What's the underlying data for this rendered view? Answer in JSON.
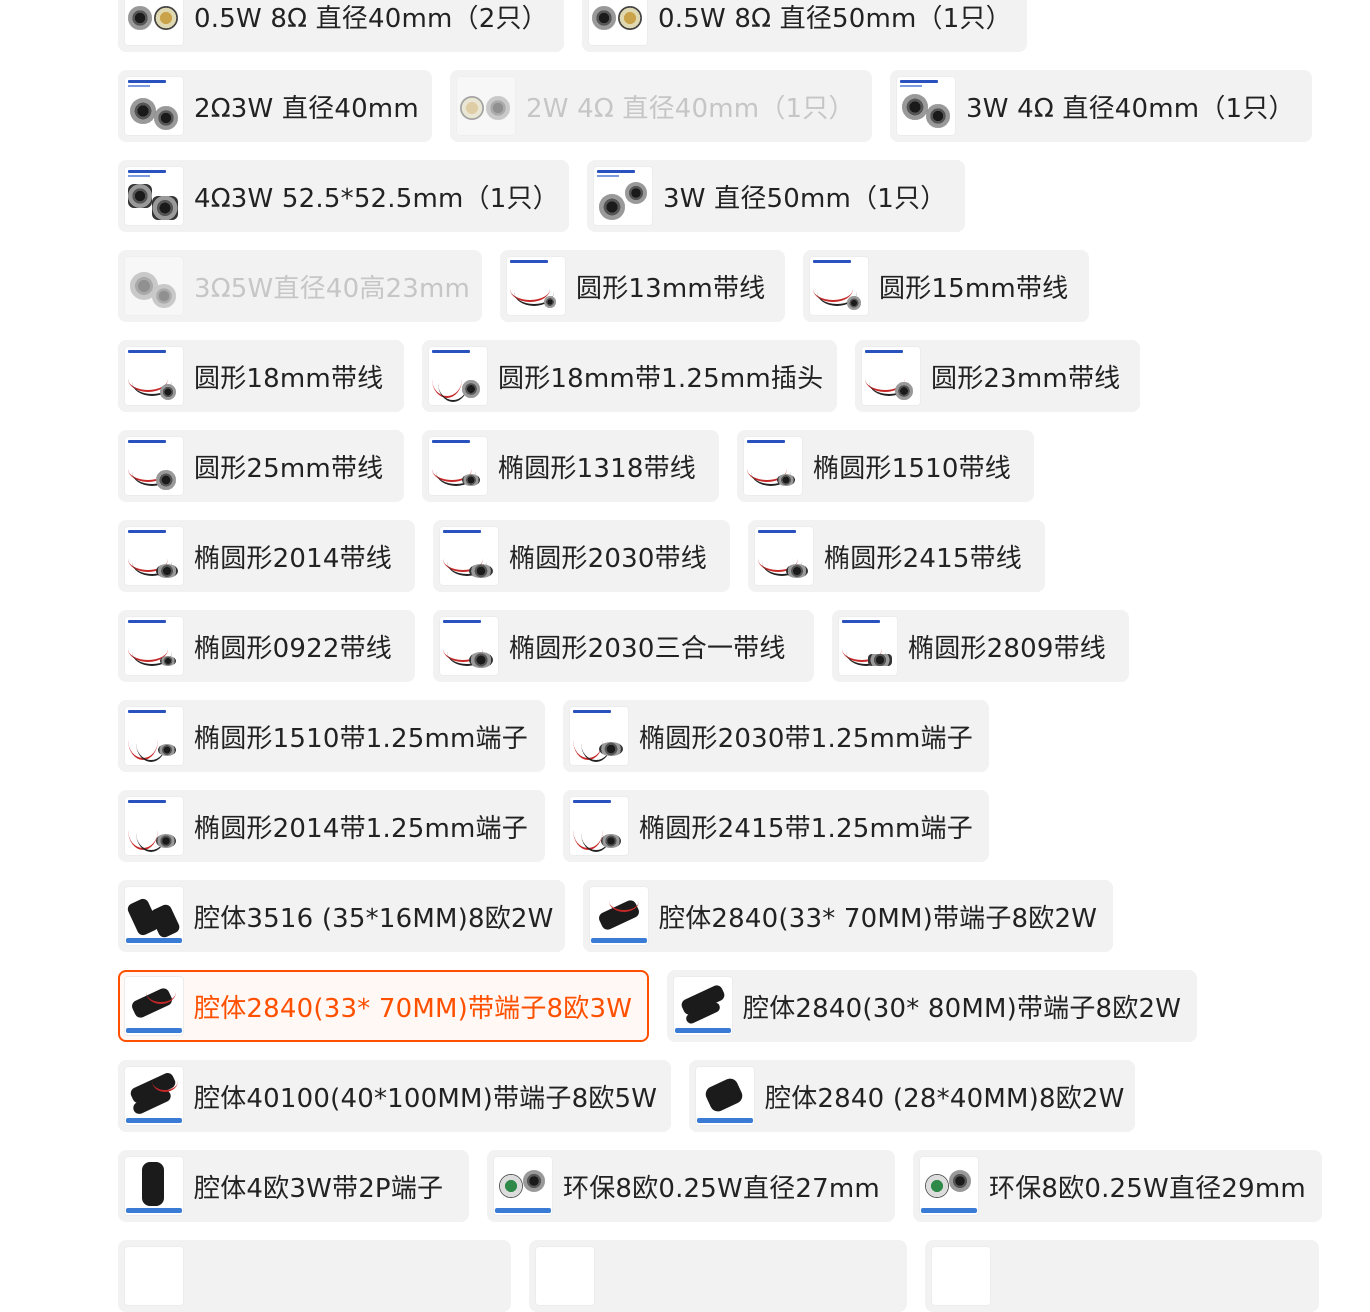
{
  "options": {
    "r1": [
      {
        "label": "0.5W 8Ω 直径40mm（2只）",
        "thumb": "speaker-pair-icon",
        "state": "normal"
      },
      {
        "label": "0.5W 8Ω 直径50mm（1只）",
        "thumb": "speaker-pair-icon",
        "state": "normal"
      }
    ],
    "r2": [
      {
        "label": "2Ω3W 直径40mm",
        "thumb": "speaker-pair-icon",
        "state": "normal"
      },
      {
        "label": "2W 4Ω 直径40mm（1只）",
        "thumb": "speaker-pair-icon",
        "state": "disabled"
      },
      {
        "label": "3W 4Ω 直径40mm（1只）",
        "thumb": "speaker-pair-icon",
        "state": "normal"
      }
    ],
    "r3": [
      {
        "label": "4Ω3W 52.5*52.5mm（1只）",
        "thumb": "speaker-pair-icon",
        "state": "normal"
      },
      {
        "label": "3W 直径50mm（1只）",
        "thumb": "speaker-pair-icon",
        "state": "normal"
      }
    ],
    "r4": [
      {
        "label": "3Ω5W直径40高23mm",
        "thumb": "speaker-pair-icon",
        "state": "disabled"
      },
      {
        "label": "圆形13mm带线",
        "thumb": "wired-speaker-icon",
        "state": "normal"
      },
      {
        "label": "圆形15mm带线",
        "thumb": "wired-speaker-icon",
        "state": "normal"
      }
    ],
    "r5": [
      {
        "label": "圆形18mm带线",
        "thumb": "wired-speaker-icon",
        "state": "normal"
      },
      {
        "label": "圆形18mm带1.25mm插头",
        "thumb": "wired-speaker-icon",
        "state": "normal"
      },
      {
        "label": "圆形23mm带线",
        "thumb": "wired-speaker-icon",
        "state": "normal"
      }
    ],
    "r6": [
      {
        "label": "圆形25mm带线",
        "thumb": "wired-speaker-icon",
        "state": "normal"
      },
      {
        "label": "椭圆形1318带线",
        "thumb": "wired-speaker-icon",
        "state": "normal"
      },
      {
        "label": "椭圆形1510带线",
        "thumb": "wired-speaker-icon",
        "state": "normal"
      }
    ],
    "r7": [
      {
        "label": "椭圆形2014带线",
        "thumb": "wired-speaker-icon",
        "state": "normal"
      },
      {
        "label": "椭圆形2030带线",
        "thumb": "wired-speaker-icon",
        "state": "normal"
      },
      {
        "label": "椭圆形2415带线",
        "thumb": "wired-speaker-icon",
        "state": "normal"
      }
    ],
    "r8": [
      {
        "label": "椭圆形0922带线",
        "thumb": "wired-speaker-icon",
        "state": "normal"
      },
      {
        "label": "椭圆形2030三合一带线",
        "thumb": "wired-speaker-icon",
        "state": "normal"
      },
      {
        "label": "椭圆形2809带线",
        "thumb": "wired-speaker-icon",
        "state": "normal"
      }
    ],
    "r9": [
      {
        "label": "椭圆形1510带1.25mm端子",
        "thumb": "wired-speaker-icon",
        "state": "normal"
      },
      {
        "label": "椭圆形2030带1.25mm端子",
        "thumb": "wired-speaker-icon",
        "state": "normal"
      }
    ],
    "r10": [
      {
        "label": "椭圆形2014带1.25mm端子",
        "thumb": "wired-speaker-icon",
        "state": "normal"
      },
      {
        "label": "椭圆形2415带1.25mm端子",
        "thumb": "wired-speaker-icon",
        "state": "normal"
      }
    ],
    "r11": [
      {
        "label": "腔体3516 (35*16MM)8欧2W",
        "thumb": "cavity-speaker-icon",
        "state": "normal"
      },
      {
        "label": "腔体2840(33* 70MM)带端子8欧2W",
        "thumb": "cavity-speaker-icon",
        "state": "normal"
      }
    ],
    "r12": [
      {
        "label": "腔体2840(33* 70MM)带端子8欧3W",
        "thumb": "cavity-speaker-icon",
        "state": "selected"
      },
      {
        "label": "腔体2840(30* 80MM)带端子8欧2W",
        "thumb": "cavity-speaker-icon",
        "state": "normal"
      }
    ],
    "r13": [
      {
        "label": "腔体40100(40*100MM)带端子8欧5W",
        "thumb": "cavity-speaker-icon",
        "state": "normal"
      },
      {
        "label": "腔体2840 (28*40MM)8欧2W",
        "thumb": "cavity-speaker-icon",
        "state": "normal"
      }
    ],
    "r14": [
      {
        "label": "腔体4欧3W带2P端子",
        "thumb": "cavity-speaker-icon",
        "state": "normal"
      },
      {
        "label": "环保8欧0.25W直径27mm",
        "thumb": "speaker-pair-icon",
        "state": "normal"
      },
      {
        "label": "环保8欧0.25W直径29mm",
        "thumb": "speaker-pair-icon",
        "state": "normal"
      }
    ]
  },
  "colors": {
    "chip_bg": "#f2f2f2",
    "text": "#222222",
    "disabled_text": "#c6c6c6",
    "selected_accent": "#ff5000"
  }
}
